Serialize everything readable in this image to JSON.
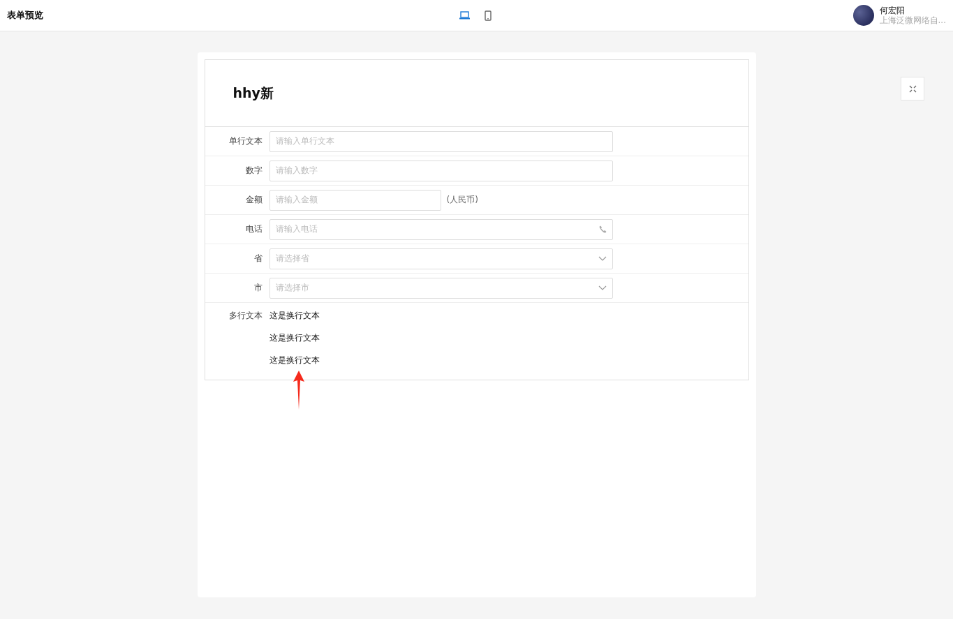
{
  "header": {
    "title": "表单预览",
    "devices": [
      {
        "kind": "desktop",
        "selected": true
      },
      {
        "kind": "mobile",
        "selected": false
      }
    ],
    "user": {
      "name": "何宏阳",
      "org": "上海泛微网络自..."
    }
  },
  "form": {
    "title": "hhy新",
    "fields": [
      {
        "kind": "input",
        "label": "单行文本",
        "placeholder": "请输入单行文本"
      },
      {
        "kind": "input",
        "label": "数字",
        "placeholder": "请输入数字"
      },
      {
        "kind": "money",
        "label": "金额",
        "placeholder": "请输入金额",
        "suffix": "(人民币)"
      },
      {
        "kind": "phone",
        "label": "电话",
        "placeholder": "请输入电话"
      },
      {
        "kind": "select",
        "label": "省",
        "placeholder": "请选择省"
      },
      {
        "kind": "select",
        "label": "市",
        "placeholder": "请选择市"
      },
      {
        "kind": "multiline",
        "label": "多行文本",
        "lines": [
          "这是换行文本",
          "这是换行文本",
          "这是换行文本"
        ]
      }
    ]
  }
}
